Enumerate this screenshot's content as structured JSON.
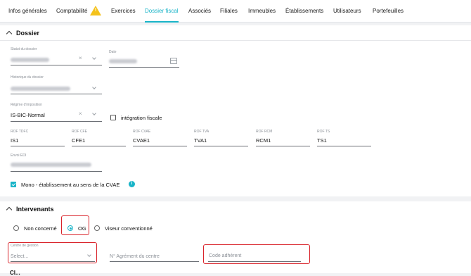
{
  "tabs": [
    {
      "label": "Infos générales",
      "active": false
    },
    {
      "label": "Comptabilité",
      "active": false
    },
    {
      "label": "Exercices",
      "active": false
    },
    {
      "label": "Dossier fiscal",
      "active": true
    },
    {
      "label": "Associés",
      "active": false
    },
    {
      "label": "Filiales",
      "active": false
    },
    {
      "label": "Immeubles",
      "active": false
    },
    {
      "label": "Établissements",
      "active": false
    },
    {
      "label": "Utilisateurs",
      "active": false
    },
    {
      "label": "Portefeuilles",
      "active": false
    }
  ],
  "warning_badge": "!",
  "dossier": {
    "title": "Dossier",
    "statut_label": "Statut du dossier",
    "date_label": "Date",
    "historique_label": "Historique du dossier",
    "regime_label": "Régime d'imposition",
    "regime_value": "IS-BIC-Normal",
    "integration_label": "intégration fiscale",
    "rof": [
      {
        "label": "ROF TDFC",
        "value": "IS1"
      },
      {
        "label": "ROF CFE",
        "value": "CFE1"
      },
      {
        "label": "ROF CVAE",
        "value": "CVAE1"
      },
      {
        "label": "ROF TVA",
        "value": "TVA1"
      },
      {
        "label": "ROF RCM",
        "value": "RCM1"
      },
      {
        "label": "ROF TS",
        "value": "TS1"
      }
    ],
    "envoi_label": "Envoi EDI",
    "mono_label": "Mono - établissement au sens de la CVAE",
    "info_glyph": "i",
    "clear_glyph": "×"
  },
  "intervenants": {
    "title": "Intervenants",
    "radios": [
      {
        "label": "Non concerné",
        "selected": false
      },
      {
        "label": "OG",
        "selected": true
      },
      {
        "label": "Viseur conventionné",
        "selected": false
      }
    ],
    "centre_label": "Centre de gestion",
    "centre_placeholder": "Select...",
    "agrement_placeholder": "N° Agrément du centre",
    "code_placeholder": "Code adhérent"
  },
  "next_section_title": "Cl...",
  "colors": {
    "accent": "#19b4c8",
    "highlight": "#d9242b",
    "warning": "#f4c21b"
  }
}
